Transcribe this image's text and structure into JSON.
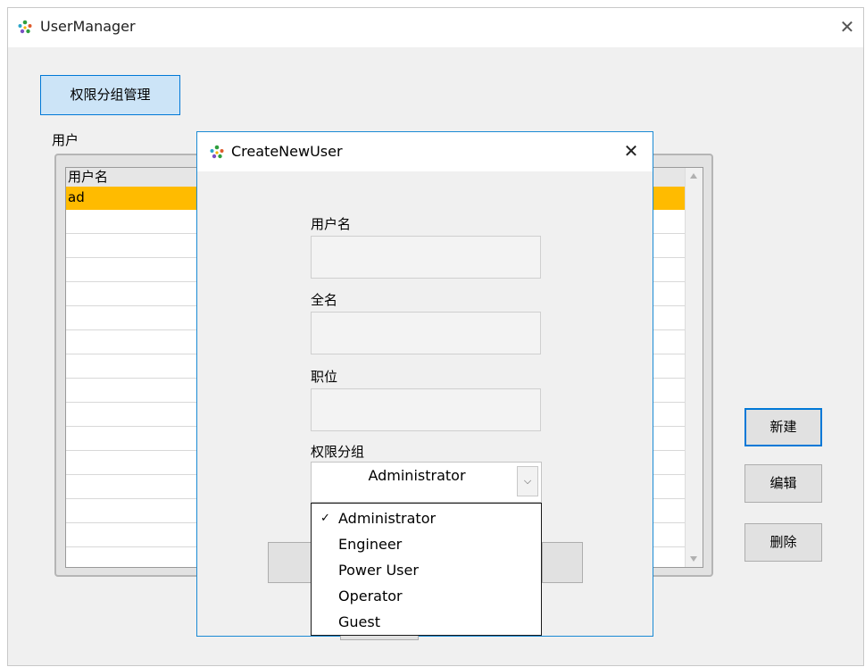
{
  "main_window": {
    "title": "UserManager",
    "close_glyph": "✕",
    "permission_group_button": "权限分组管理",
    "users_section_label": "用户",
    "users_table": {
      "column_header": "用户名",
      "rows": [
        "ad"
      ]
    },
    "side_buttons": {
      "new": "新建",
      "edit": "编辑",
      "delete": "删除"
    }
  },
  "dialog": {
    "title": "CreateNewUser",
    "close_glyph": "✕",
    "fields": {
      "username_label": "用户名",
      "fullname_label": "全名",
      "position_label": "职位",
      "group_label": "权限分组"
    },
    "username_value": "",
    "fullname_value": "",
    "position_value": "",
    "group_selected": "Administrator",
    "group_options": [
      "Administrator",
      "Engineer",
      "Power User",
      "Operator",
      "Guest"
    ],
    "check_glyph": "✓",
    "dropdown_arrow_glyph": "⌵"
  },
  "colors": {
    "selected_row": "#ffbb00",
    "accent_border": "#0078d7",
    "dialog_border": "#1a8ad4",
    "perm_button_bg": "#cce4f7"
  }
}
